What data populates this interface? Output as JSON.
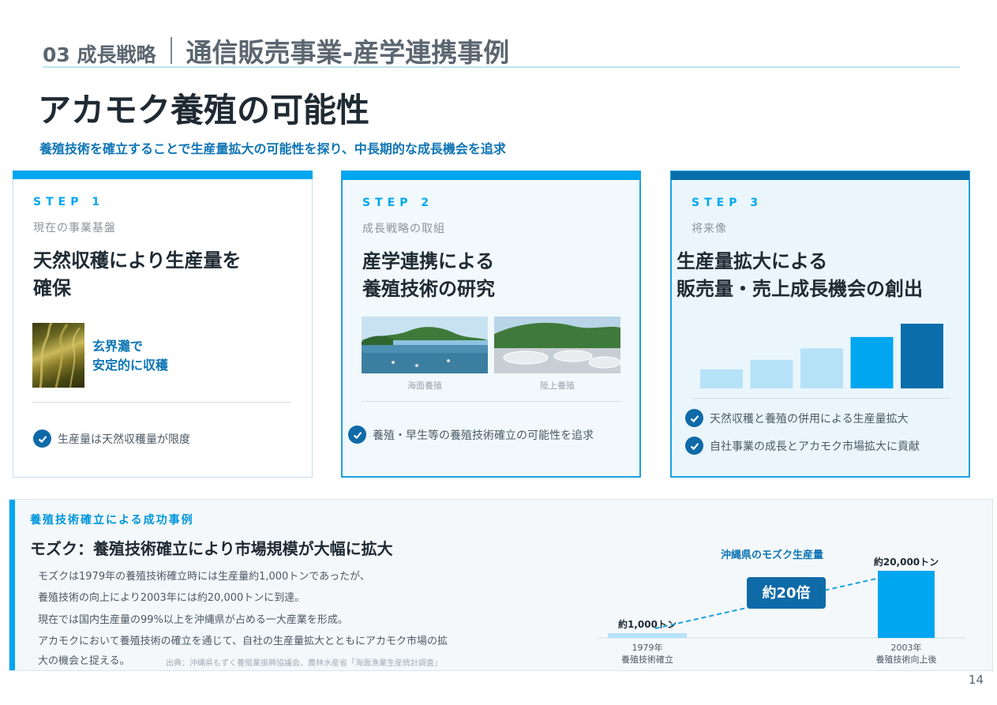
{
  "header": {
    "section_number": "03 成長戦略",
    "section_title": "通信販売事業-産学連携事例"
  },
  "title": "アカモク養殖の可能性",
  "subtitle": "養殖技術を確立することで生産量拡大の可能性を探り、中長期的な成長機会を追求",
  "steps": [
    {
      "label": "STEP 1",
      "sub": "現在の事業基盤",
      "title": "天然収穫により生産量を\n確保",
      "image_text": "玄界灘で\n安定的に収穫",
      "checks": [
        "生産量は天然収穫量が限度"
      ]
    },
    {
      "label": "STEP 2",
      "sub": "成長戦略の取組",
      "title": "産学連携による\n養殖技術の研究",
      "captions": [
        "海面養殖",
        "陸上養殖"
      ],
      "checks": [
        "養殖・早生等の養殖技術確立の可能性を追求"
      ]
    },
    {
      "label": "STEP 3",
      "sub": "将来像",
      "title": "生産量拡大による\n販売量・売上成長機会の創出",
      "checks": [
        "天然収穫と養殖の併用による生産量拡大",
        "自社事業の成長とアカモク市場拡大に貢献"
      ]
    }
  ],
  "case": {
    "label": "養殖技術確立による成功事例",
    "title": "モズク：養殖技術確立により市場規模が大幅に拡大",
    "lines": [
      "モズクは1979年の養殖技術確立時には生産量約1,000トンであったが、",
      "養殖技術の向上により2003年には約20,000トンに到達。",
      "現在では国内生産量の99%以上を沖縄県が占める一大産業を形成。",
      "アカモクにおいて養殖技術の確立を通じて、自社の生産量拡大とともにアカモク市場の拡",
      "大の機会と捉える。"
    ],
    "source": "出典：沖縄県もずく養殖業振興協議会、農林水産省「海面漁業生産統計調査」"
  },
  "page_number": "14",
  "colors": {
    "accent": "#00a6f0",
    "dark_accent": "#0a6eab",
    "text_blue": "#0f75b5"
  },
  "chart_data": [
    {
      "type": "bar",
      "title": "",
      "categories": [
        "1",
        "2",
        "3",
        "4",
        "5"
      ],
      "values": [
        1,
        1.5,
        2.1,
        2.7,
        3.4
      ],
      "colors": [
        "#b6e2f8",
        "#b6e2f8",
        "#b6e2f8",
        "#00a6f0",
        "#0a6eab"
      ]
    },
    {
      "type": "bar",
      "title": "沖縄県のモズク生産量",
      "categories": [
        "1979年\n養殖技術確立",
        "2003年\n養殖技術向上後"
      ],
      "category_lines": [
        [
          "1979年",
          "養殖技術確立"
        ],
        [
          "2003年",
          "養殖技術向上後"
        ]
      ],
      "values": [
        1000,
        20000
      ],
      "value_labels": [
        "約1,000トン",
        "約20,000トン"
      ],
      "annotation": "約20倍",
      "colors": [
        "#b6e2f8",
        "#00a6f0"
      ],
      "units": "トン"
    }
  ]
}
